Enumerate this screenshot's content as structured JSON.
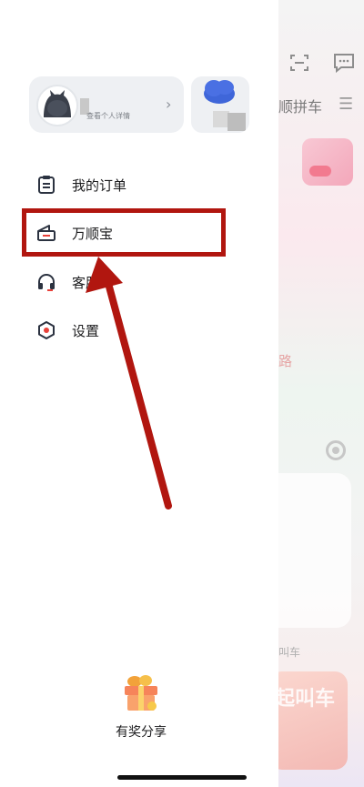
{
  "background_app": {
    "tab_fragment": "顺拼车",
    "route_fragment": "路",
    "label_fragment": "叫车",
    "promo_fragment": "起叫车",
    "icons": [
      "scan-icon",
      "message-icon",
      "menu-icon",
      "locate-icon"
    ]
  },
  "drawer": {
    "profile": {
      "subtitle": "查看个人详情",
      "chevron": "›"
    },
    "menu": [
      {
        "label": "我的订单",
        "icon": "order-icon"
      },
      {
        "label": "万顺宝",
        "icon": "wallet-icon"
      },
      {
        "label": "客服",
        "icon": "headset-icon"
      },
      {
        "label": "设置",
        "icon": "settings-icon"
      }
    ],
    "share": {
      "label": "有奖分享",
      "icon": "gift-icon"
    }
  },
  "annotation": {
    "highlight_color": "#b1160f",
    "highlighted_item": "万顺宝"
  },
  "colors": {
    "accent_red": "#b1160f",
    "icon_dark": "#2b3240",
    "text": "#1c1c1e"
  }
}
